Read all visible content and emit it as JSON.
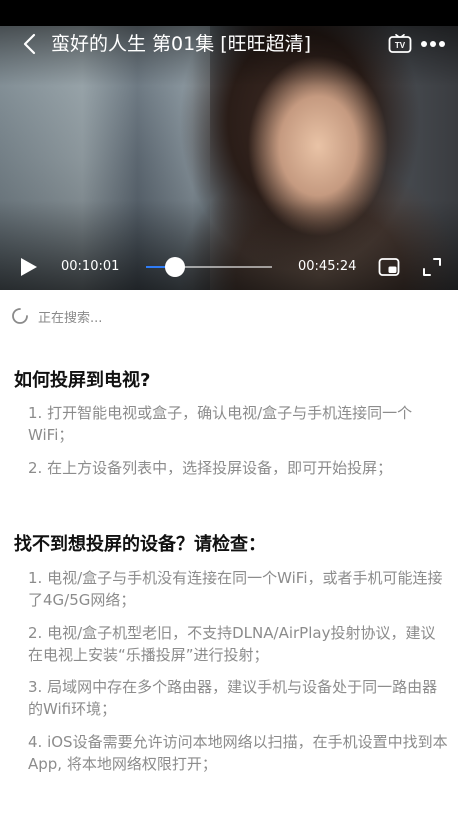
{
  "player": {
    "title": "蛮好的人生 第01集 [旺旺超清]",
    "current_time": "00:10:01",
    "total_time": "00:45:24",
    "progress": 0.22,
    "icons": {
      "back": "chevron-left-icon",
      "tv": "tv-icon",
      "more": "more-dots-icon",
      "play": "play-icon",
      "pip": "picture-in-picture-icon",
      "fullscreen": "fullscreen-icon"
    }
  },
  "search": {
    "status": "正在搜索...",
    "icon": "loading-spinner-icon"
  },
  "howto": {
    "title": "如何投屏到电视?",
    "steps": [
      "1. 打开智能电视或盒子，确认电视/盒子与手机连接同一个WiFi；",
      "2. 在上方设备列表中，选择投屏设备，即可开始投屏；"
    ]
  },
  "troubleshoot": {
    "title": "找不到想投屏的设备？请检查：",
    "items": [
      "1. 电视/盒子与手机没有连接在同一个WiFi，或者手机可能连接了4G/5G网络；",
      "2. 电视/盒子机型老旧，不支持DLNA/AirPlay投射协议，建议在电视上安装“乐播投屏”进行投射；",
      "3. 局域网中存在多个路由器，建议手机与设备处于同一路由器的Wifi环境；",
      "4. iOS设备需要允许访问本地网络以扫描，在手机设置中找到本App, 将本地网络权限打开；"
    ]
  },
  "colors": {
    "accent": "#2f7cf6",
    "tip_text": "#8c8c8c",
    "heading_text": "#111111"
  }
}
